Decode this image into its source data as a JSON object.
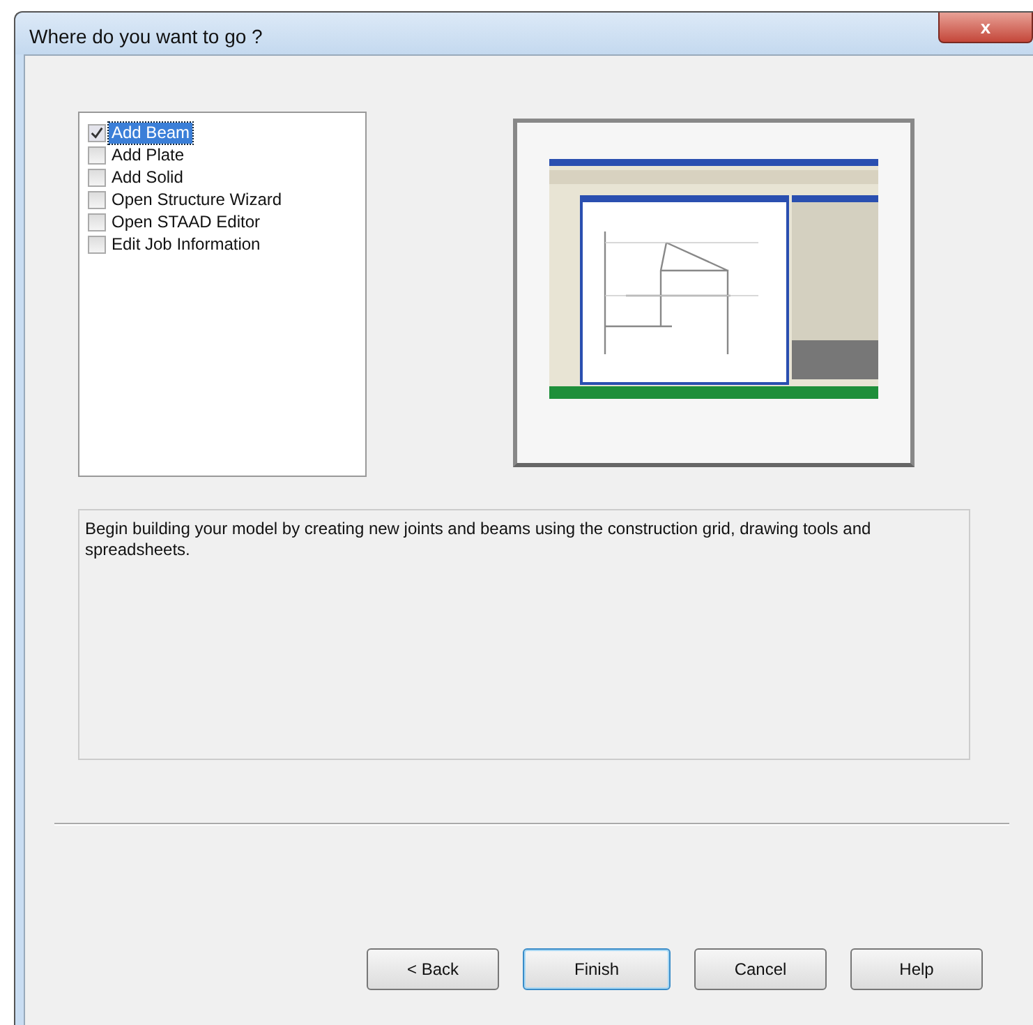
{
  "window": {
    "title": "Where do you want to go ?",
    "close": "x"
  },
  "options": [
    {
      "label": "Add Beam",
      "checked": true,
      "selected": true
    },
    {
      "label": "Add Plate",
      "checked": false,
      "selected": false
    },
    {
      "label": "Add Solid",
      "checked": false,
      "selected": false
    },
    {
      "label": "Open Structure Wizard",
      "checked": false,
      "selected": false
    },
    {
      "label": "Open STAAD Editor",
      "checked": false,
      "selected": false
    },
    {
      "label": "Edit Job Information",
      "checked": false,
      "selected": false
    }
  ],
  "description": "Begin building your model by creating new joints and beams using the construction grid, drawing tools and spreadsheets.",
  "buttons": [
    {
      "label": "< Back",
      "selected": false
    },
    {
      "label": "Finish",
      "selected": true
    },
    {
      "label": "Cancel",
      "selected": false
    },
    {
      "label": "Help",
      "selected": false
    }
  ]
}
